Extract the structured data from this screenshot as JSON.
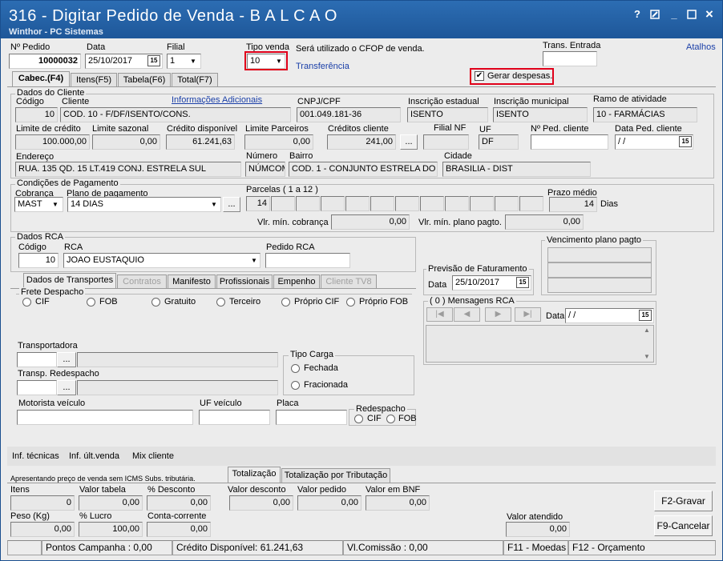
{
  "window": {
    "title": "316 - Digitar Pedido de Venda - B A L C A O",
    "subtitle": "Winthor - PC Sistemas",
    "help": "?",
    "minimize": "_",
    "close": "×"
  },
  "header": {
    "num_pedido_label": "Nº Pedido",
    "num_pedido": "10000032",
    "data_label": "Data",
    "data": "25/10/2017",
    "filial_label": "Filial",
    "filial": "1",
    "tipo_venda_label": "Tipo venda",
    "tipo_venda": "10",
    "cfop_note": "Será utilizado o CFOP de venda.",
    "transferencia": "Transferência",
    "trans_entrada_label": "Trans. Entrada",
    "trans_entrada": "",
    "atalhos": "Atalhos",
    "gerar_despesas_label": "Gerar despesas.",
    "gerar_despesas_check": "✔"
  },
  "tabs": [
    {
      "label": "Cabec.(F4)"
    },
    {
      "label": "Itens(F5)"
    },
    {
      "label": "Tabela(F6)"
    },
    {
      "label": "Total(F7)"
    }
  ],
  "cliente": {
    "group_title": "Dados do Cliente",
    "codigo_label": "Código",
    "codigo": "10",
    "cliente_label": "Cliente",
    "cliente": "COD. 10 - F/DF/ISENTO/CONS.",
    "info_adicionais": "Informações Adicionais",
    "cnpj_label": "CNPJ/CPF",
    "cnpj": "001.049.181-36",
    "ie_label": "Inscrição estadual",
    "ie": "ISENTO",
    "im_label": "Inscrição municipal",
    "im": "ISENTO",
    "ramo_label": "Ramo de atividade",
    "ramo": "10 - FARMÁCIAS",
    "limite_credito_label": "Limite de crédito",
    "limite_credito": "100.000,00",
    "limite_sazonal_label": "Limite sazonal",
    "limite_sazonal": "0,00",
    "credito_disp_label": "Crédito disponível",
    "credito_disp": "61.241,63",
    "limite_parceiros_label": "Limite Parceiros",
    "limite_parceiros": "0,00",
    "creditos_cliente_label": "Créditos cliente",
    "creditos_cliente": "241,00",
    "filial_nf_label": "Filial NF",
    "filial_nf": "",
    "uf_label": "UF",
    "uf": "DF",
    "num_ped_cliente_label": "Nº Ped. cliente",
    "num_ped_cliente": "",
    "data_ped_cliente_label": "Data Ped. cliente",
    "data_ped_cliente": " / /",
    "endereco_label": "Endereço",
    "endereco": "RUA. 135 QD. 15 LT.419 CONJ. ESTRELA SUL",
    "numero_label": "Número",
    "numero": "NÚMCOM",
    "bairro_label": "Bairro",
    "bairro": "COD. 1 - CONJUNTO ESTRELA DO SU",
    "cidade_label": "Cidade",
    "cidade": "BRASILIA - DIST"
  },
  "pagamento": {
    "group_title": "Condições de Pagamento",
    "cobranca_label": "Cobrança",
    "cobranca": "MAST",
    "plano_label": "Plano de pagamento",
    "plano": "14 DIAS",
    "parcelas_label": "Parcelas ( 1 a 12 )",
    "parcela1": "14",
    "prazo_medio_label": "Prazo médio",
    "prazo_medio": "14",
    "dias": "Dias",
    "vlr_min_cobranca_label": "Vlr. mín. cobrança",
    "vlr_min_cobranca": "0,00",
    "vlr_min_plano_label": "Vlr. mín. plano pagto.",
    "vlr_min_plano": "0,00"
  },
  "rca": {
    "group_title": "Dados RCA",
    "codigo_label": "Código",
    "codigo": "10",
    "rca_label": "RCA",
    "rca": "JOAO EUSTAQUIO",
    "pedido_rca_label": "Pedido RCA",
    "pedido_rca": ""
  },
  "vencimento": {
    "group_title": "Vencimento plano pagto"
  },
  "previsao": {
    "group_title": "Previsão de Faturamento",
    "data_label": "Data",
    "data": "25/10/2017"
  },
  "mensagens": {
    "group_title": "( 0 ) Mensagens RCA",
    "data_label": "Data",
    "data": " / /"
  },
  "subtabs": [
    {
      "label": "Dados de Transportes"
    },
    {
      "label": "Contratos"
    },
    {
      "label": "Manifesto"
    },
    {
      "label": "Profissionais"
    },
    {
      "label": "Empenho"
    },
    {
      "label": "Cliente TV8"
    }
  ],
  "transporte": {
    "frete_title": "Frete Despacho",
    "frete_options": [
      "CIF",
      "FOB",
      "Gratuito",
      "Terceiro",
      "Próprio CIF",
      "Próprio FOB"
    ],
    "transportadora_label": "Transportadora",
    "transp_redespacho_label": "Transp. Redespacho",
    "tipo_carga_title": "Tipo Carga",
    "tipo_carga_options": [
      "Fechada",
      "Fracionada"
    ],
    "motorista_label": "Motorista veículo",
    "uf_veiculo_label": "UF veículo",
    "placa_label": "Placa",
    "redespacho_title": "Redespacho",
    "redespacho_options": [
      "CIF",
      "FOB"
    ]
  },
  "links": {
    "inf_tecnicas": "Inf. técnicas",
    "inf_ult_venda": "Inf. últ.venda",
    "mix_cliente": "Mix cliente"
  },
  "totalizacao": {
    "note": "Apresentando preço de venda sem ICMS Subs. tributária.",
    "tab1": "Totalização",
    "tab2": "Totalização por Tributação",
    "itens_label": "Itens",
    "itens": "0",
    "valor_tabela_label": "Valor tabela",
    "valor_tabela": "0,00",
    "pct_desconto_label": "% Desconto",
    "pct_desconto": "0,00",
    "valor_desconto_label": "Valor desconto",
    "valor_desconto": "0,00",
    "valor_pedido_label": "Valor pedido",
    "valor_pedido": "0,00",
    "valor_bnf_label": "Valor em BNF",
    "valor_bnf": "0,00",
    "peso_label": "Peso (Kg)",
    "peso": "0,00",
    "pct_lucro_label": "% Lucro",
    "pct_lucro": "100,00",
    "conta_corrente_label": "Conta-corrente",
    "conta_corrente": "0,00",
    "valor_atendido_label": "Valor atendido",
    "valor_atendido": "0,00",
    "f2": "F2-Gravar",
    "f9": "F9-Cancelar"
  },
  "status": {
    "pontos": "Pontos Campanha : 0,00",
    "credito": "Crédito Disponível: 61.241,63",
    "comissao": "Vl.Comissão : 0,00",
    "f11": "F11 - Moedas",
    "f12": "F12 - Orçamento"
  },
  "icons": {
    "calendar": "15",
    "dropdown": "▼",
    "ellipsis": "...",
    "nav_first": "|◀",
    "nav_prev": "◀",
    "nav_next": "▶",
    "nav_last": "▶|",
    "scroll_up": "▲",
    "scroll_down": "▼"
  }
}
